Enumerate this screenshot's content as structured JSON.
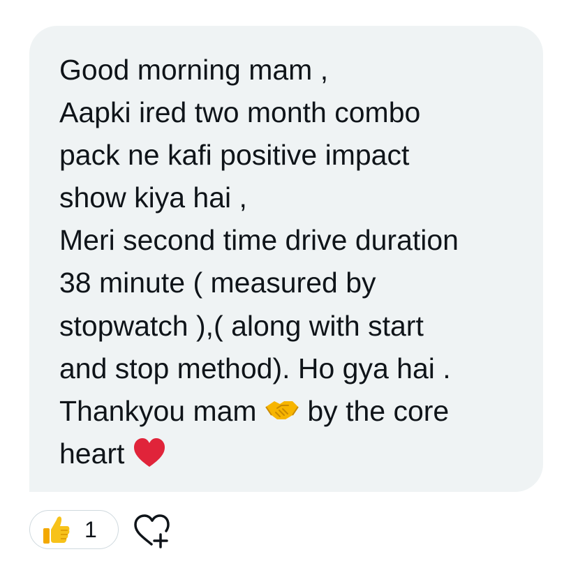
{
  "message": {
    "lines": [
      "Good morning mam ,",
      "Aapki ired two month combo",
      "pack ne kafi positive impact",
      "show kiya hai ,",
      "Meri second time drive duration",
      "38 minute ( measured by",
      "stopwatch ),( along with start",
      "and stop method). Ho gya hai .",
      "Thankyou mam",
      "by the core",
      "heart"
    ],
    "emojis": {
      "handshake": "handshake-icon",
      "heart": "red-heart-icon"
    }
  },
  "reactions": {
    "thumbs_up_icon": "thumbs-up-icon",
    "thumbs_up_count": "1",
    "add_reaction_icon": "heart-plus-icon"
  },
  "colors": {
    "bubble": "#eff3f4",
    "text": "#0f1419",
    "heart": "#e0243a",
    "pill_border": "#cfd9de"
  }
}
